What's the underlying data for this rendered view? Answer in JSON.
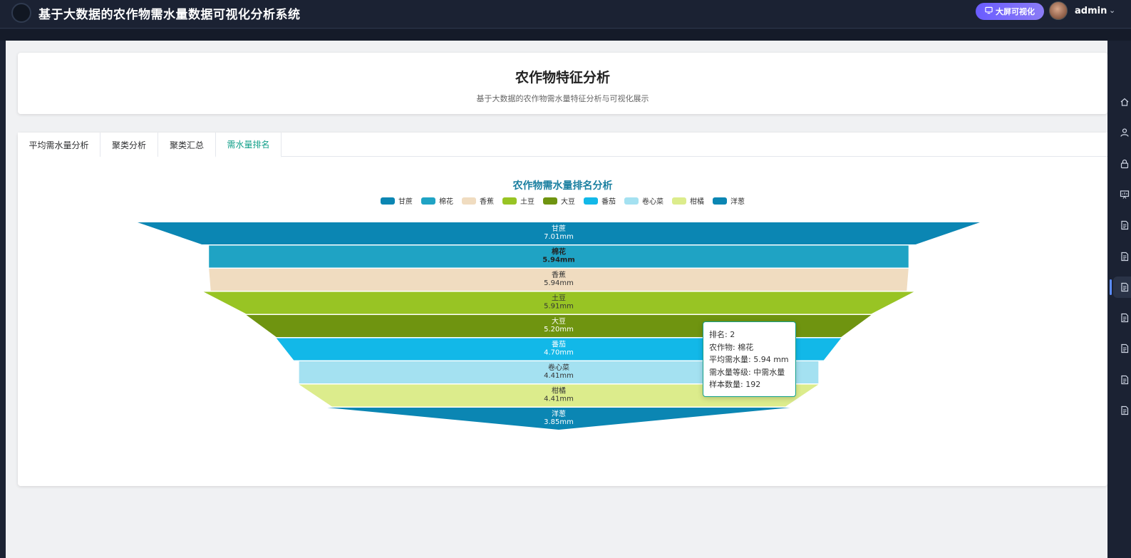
{
  "app": {
    "title": "基于大数据的农作物需水量数据可视化分析系统",
    "bigscreen_label": "大屏可视化",
    "username": "admin"
  },
  "header": {
    "title": "农作物特征分析",
    "subtitle": "基于大数据的农作物需水量特征分析与可视化展示"
  },
  "tabs": [
    {
      "label": "平均需水量分析"
    },
    {
      "label": "聚类分析"
    },
    {
      "label": "聚类汇总"
    },
    {
      "label": "需水量排名",
      "active": true
    }
  ],
  "sidebar": {
    "icons": [
      "home-icon",
      "user-icon",
      "lock-icon",
      "presentation-icon",
      "document-icon",
      "document-icon",
      "document-icon",
      "document-icon",
      "document-icon",
      "document-icon",
      "document-icon"
    ],
    "active_index": 6
  },
  "chart_data": {
    "type": "funnel",
    "title": "农作物需水量排名分析",
    "unit": "mm",
    "series": [
      {
        "name": "甘蔗",
        "value": 7.01,
        "label": "7.01mm",
        "color": "#0b86b3"
      },
      {
        "name": "棉花",
        "value": 5.94,
        "label": "5.94mm",
        "color": "#1fa3c4"
      },
      {
        "name": "香蕉",
        "value": 5.94,
        "label": "5.94mm",
        "color": "#f0dcc0"
      },
      {
        "name": "土豆",
        "value": 5.91,
        "label": "5.91mm",
        "color": "#98c424"
      },
      {
        "name": "大豆",
        "value": 5.2,
        "label": "5.20mm",
        "color": "#6f9410"
      },
      {
        "name": "番茄",
        "value": 4.7,
        "label": "4.70mm",
        "color": "#12b8e8"
      },
      {
        "name": "卷心菜",
        "value": 4.41,
        "label": "4.41mm",
        "color": "#a4e1f1"
      },
      {
        "name": "柑橘",
        "value": 4.41,
        "label": "4.41mm",
        "color": "#dcec8c"
      },
      {
        "name": "洋葱",
        "value": 3.85,
        "label": "3.85mm",
        "color": "#0b86b3"
      }
    ],
    "legend_position": "top-center",
    "highlighted_index": 1
  },
  "tooltip": {
    "lines": [
      "排名: 2",
      "农作物: 棉花",
      "平均需水量: 5.94 mm",
      "需水量等级: 中需水量",
      "样本数量: 192"
    ]
  }
}
